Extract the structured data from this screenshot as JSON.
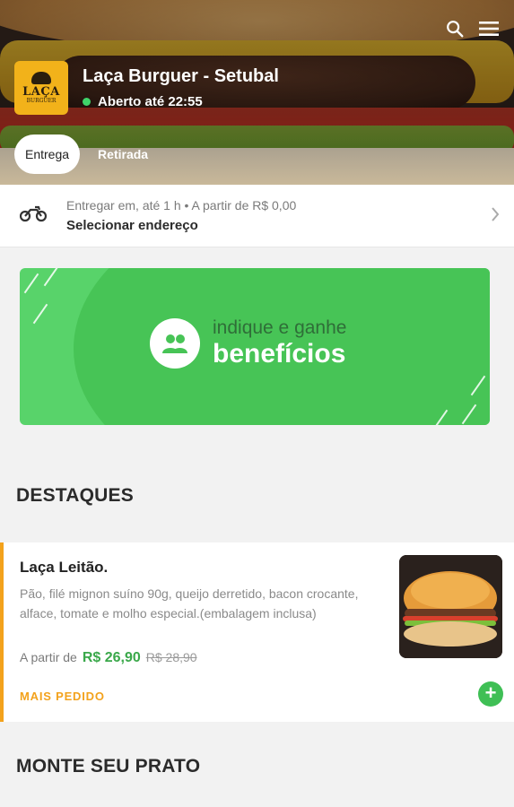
{
  "header": {
    "store_name": "Laça Burguer - Setubal",
    "status": "Aberto até 22:55",
    "logo_text_top": "LAÇA",
    "logo_text_bottom": "BURGUER",
    "icons": [
      "search-icon",
      "menu-icon"
    ],
    "tabs": [
      {
        "label": "Entrega",
        "active": true
      },
      {
        "label": "Retirada",
        "active": false
      }
    ],
    "status_color": "#3fd46a"
  },
  "delivery": {
    "info": "Entregar em, até 1 h  •  A partir de R$ 0,00",
    "action": "Selecionar endereço",
    "icon": "motorcycle-icon"
  },
  "banner": {
    "line1": "indique e ganhe",
    "line2": "benefícios",
    "icon": "people-icon",
    "color": "#58d36a"
  },
  "sections": {
    "featured_title": "DESTAQUES",
    "build_title": "MONTE SEU PRATO"
  },
  "featured_item": {
    "name": "Laça Leitão.",
    "description": "Pão, filé mignon suíno 90g, queijo derretido, bacon crocante, alface, tomate e molho especial.(embalagem inclusa)",
    "price_prefix": "A partir de",
    "price": "R$ 26,90",
    "old_price": "R$ 28,90",
    "badge": "MAIS PEDIDO",
    "add_label": "+",
    "accent_color": "#f3a21c",
    "price_color": "#3aa84a"
  }
}
